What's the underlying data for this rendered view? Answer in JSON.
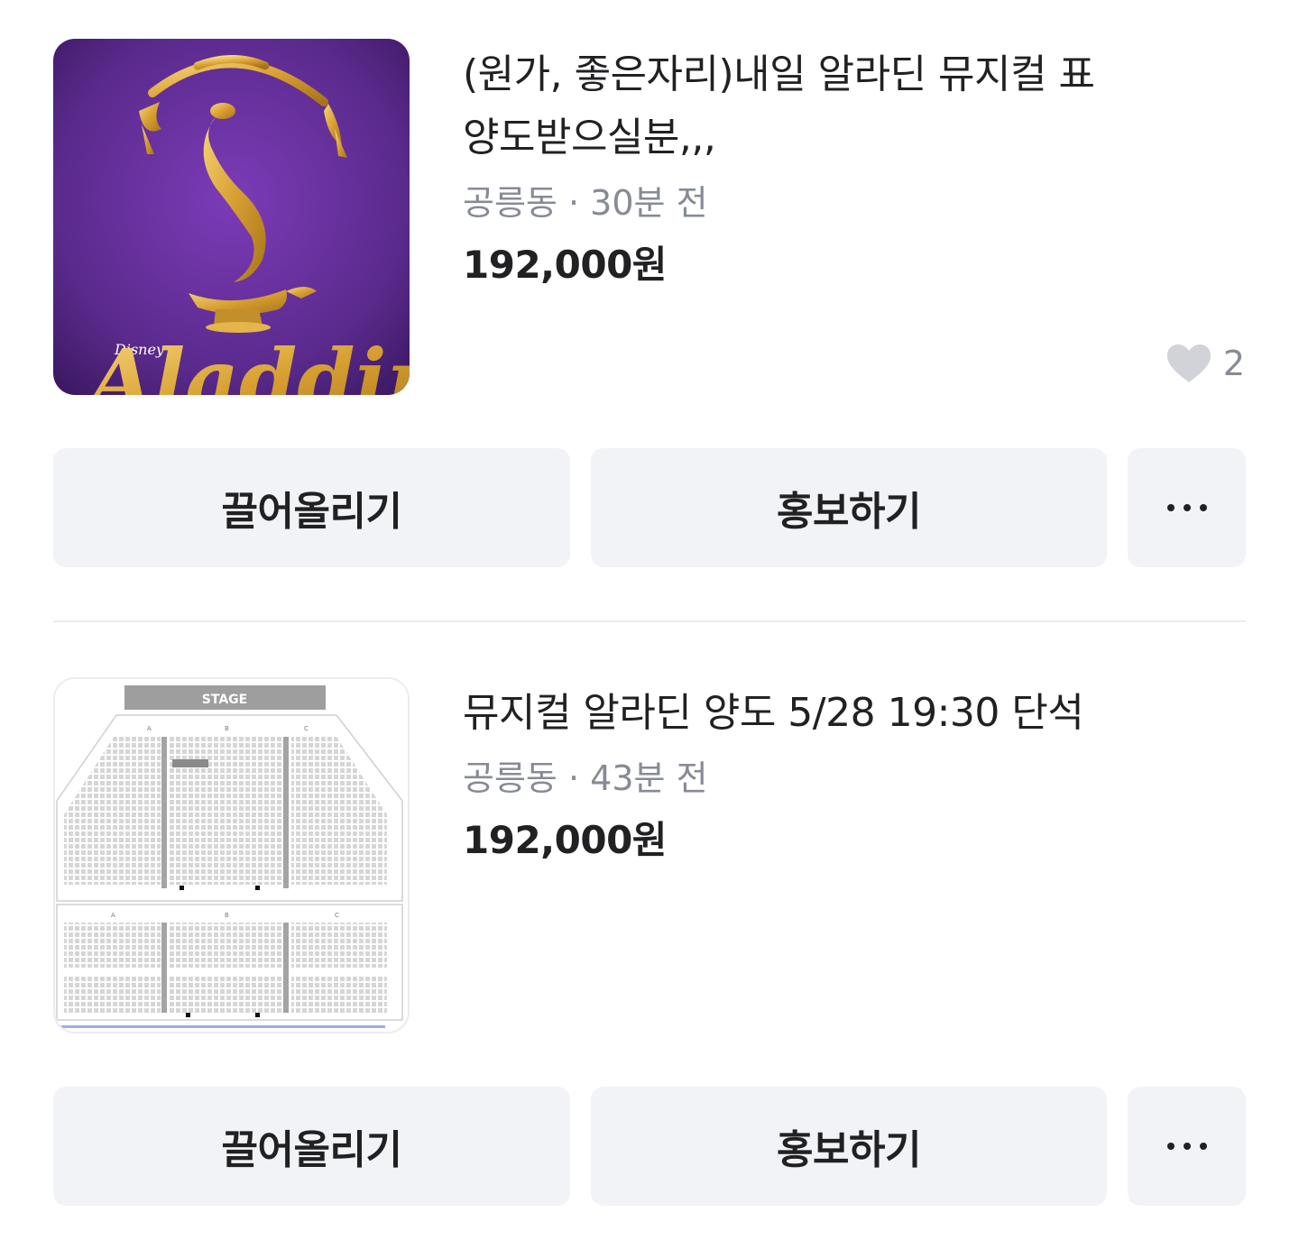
{
  "listings": [
    {
      "title_line1": "(원가, 좋은자리)내일 알라딘 뮤지컬 표",
      "title_line2": "양도받으실분,,,",
      "location": "공릉동",
      "time_ago": "30분 전",
      "separator": "·",
      "price": "192,000원",
      "likes": "2",
      "thumbnail": {
        "brand": "DISNEY",
        "wordmark": "Aladdin",
        "background": "#5b2a8e",
        "accent": "#e2b23a"
      },
      "buttons": {
        "bump": "끌어올리기",
        "promote": "홍보하기",
        "more_icon": "more-icon"
      }
    },
    {
      "title_line1": "뮤지컬 알라딘 양도 5/28 19:30 단석",
      "location": "공릉동",
      "time_ago": "43분 전",
      "separator": "·",
      "price": "192,000원",
      "thumbnail": {
        "stage_label": "STAGE",
        "sections": [
          "A",
          "B",
          "C"
        ]
      },
      "buttons": {
        "bump": "끌어올리기",
        "promote": "홍보하기",
        "more_icon": "more-icon"
      }
    }
  ],
  "colors": {
    "text": "#212124",
    "muted": "#868b94",
    "button_bg": "#f2f3f6",
    "heart": "#d1d3d8"
  }
}
